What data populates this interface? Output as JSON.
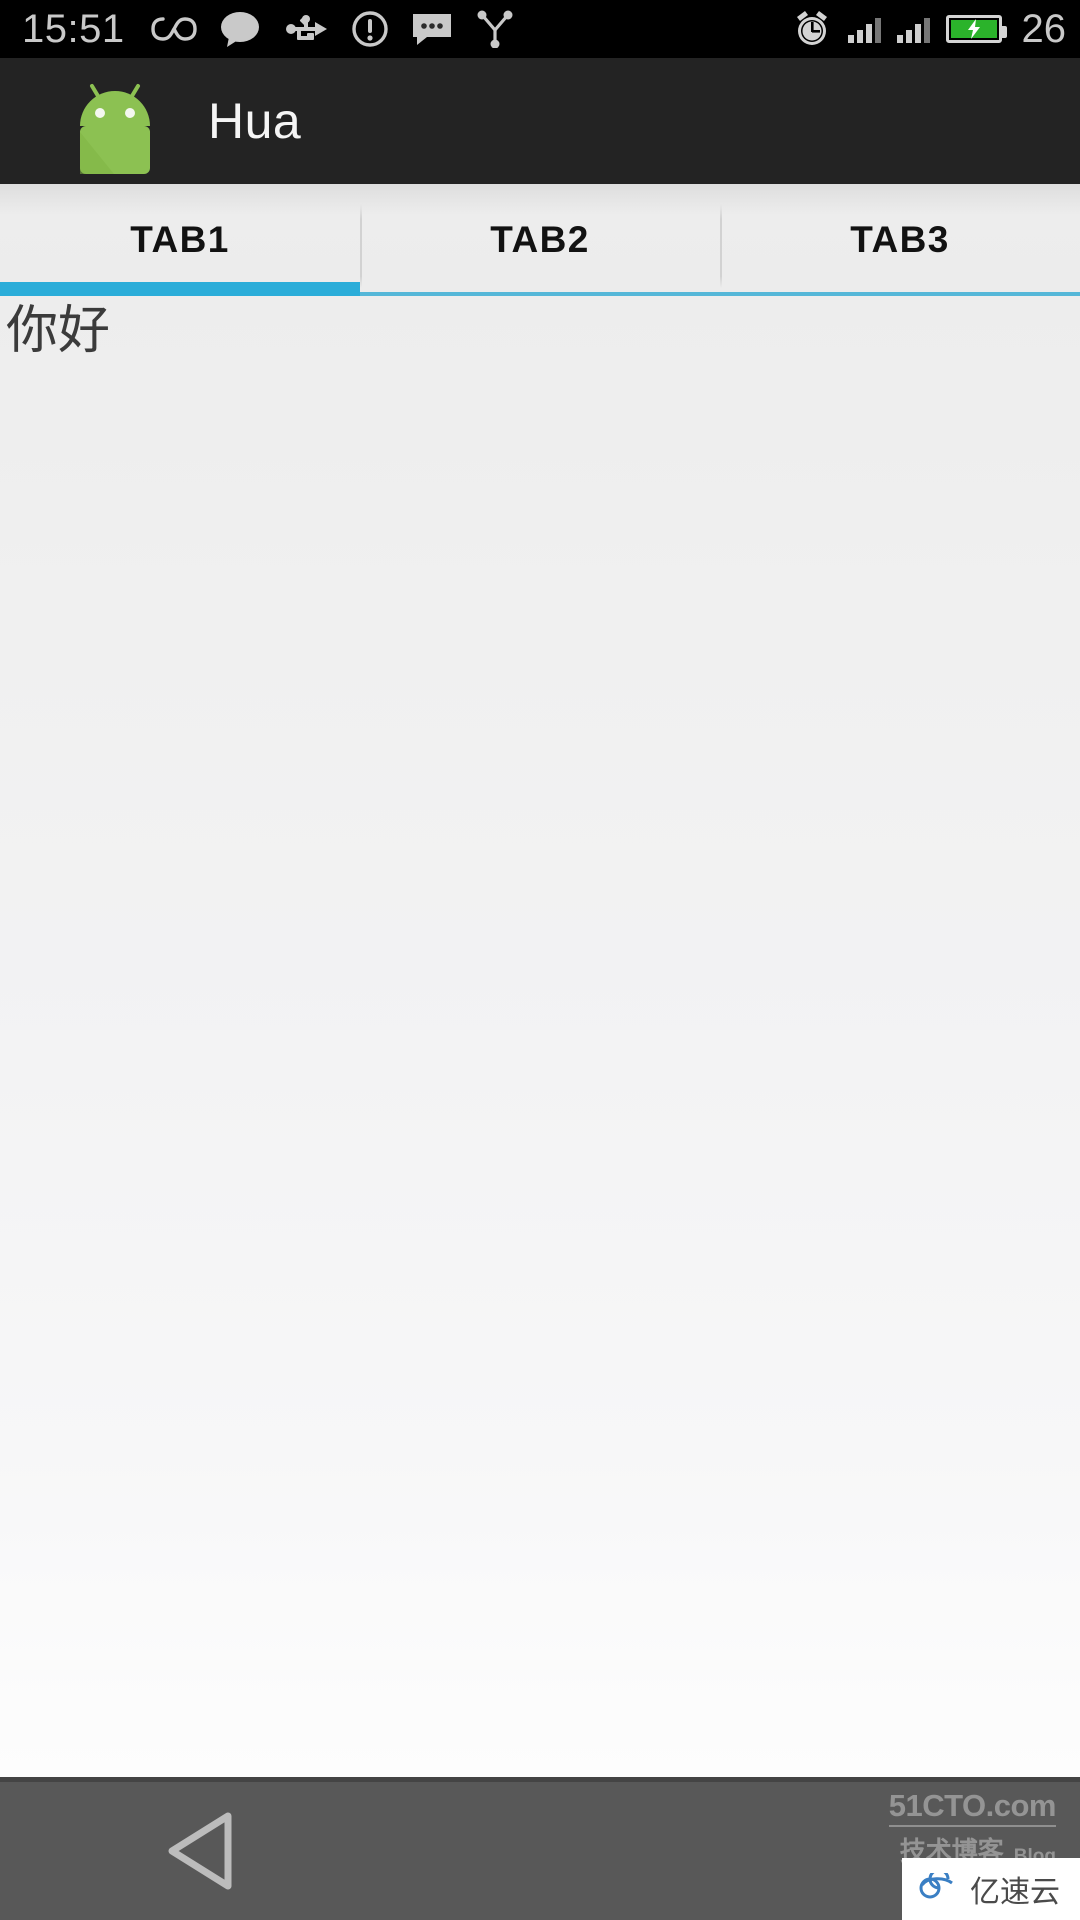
{
  "status_bar": {
    "time": "15:51",
    "battery_percent": "26",
    "icons": [
      {
        "name": "infinity-icon"
      },
      {
        "name": "speech-bubble-icon"
      },
      {
        "name": "usb-icon"
      },
      {
        "name": "warning-circle-icon"
      },
      {
        "name": "sms-message-icon"
      },
      {
        "name": "share-network-icon"
      }
    ],
    "right_icons": [
      {
        "name": "alarm-clock-icon"
      },
      {
        "name": "signal-bars-sim1-icon"
      },
      {
        "name": "signal-bars-sim2-icon"
      },
      {
        "name": "battery-charging-icon"
      }
    ]
  },
  "app_bar": {
    "title": "Hua",
    "logo_icon": "android-robot-icon"
  },
  "tabs": [
    {
      "label": "TAB1",
      "active": true
    },
    {
      "label": "TAB2",
      "active": false
    },
    {
      "label": "TAB3",
      "active": false
    }
  ],
  "content": {
    "text": "你好"
  },
  "nav_bar": {
    "back_icon": "back-triangle-icon"
  },
  "watermarks": {
    "site": "51CTO.com",
    "site_cn": "技术博客",
    "site_blog": "Blog",
    "vendor": "亿速云"
  },
  "colors": {
    "accent_blue": "#2badd9",
    "inactive_blue": "#55b7d8",
    "app_bar": "#232323",
    "status_bar": "#000000",
    "nav_bar": "#585858",
    "battery_green": "#2bb32b",
    "android_green": "#8cc152"
  }
}
